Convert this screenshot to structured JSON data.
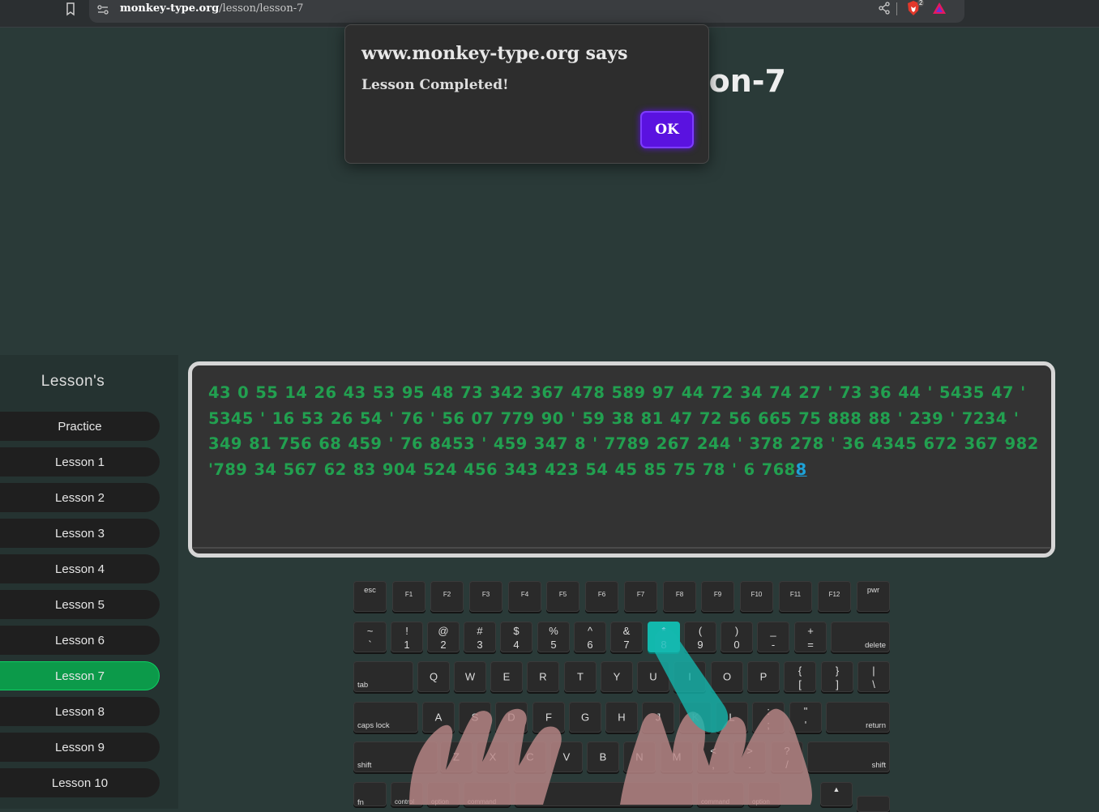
{
  "browser": {
    "url_domain": "monkey-type.org",
    "url_path": "/lesson/lesson-7",
    "brave_badge_count": "2",
    "icons": [
      "bookmark-icon",
      "site-settings-icon",
      "share-icon",
      "brave-shields-icon",
      "brave-rewards-icon"
    ]
  },
  "page": {
    "title": "Lesson-7"
  },
  "dialog": {
    "title": "www.monkey-type.org says",
    "message": "Lesson Completed!",
    "ok_label": "OK",
    "ok_color": "#5a12e0"
  },
  "sidebar": {
    "title": "Lesson's",
    "items": [
      {
        "label": "Practice"
      },
      {
        "label": "Lesson 1"
      },
      {
        "label": "Lesson 2"
      },
      {
        "label": "Lesson 3"
      },
      {
        "label": "Lesson 4"
      },
      {
        "label": "Lesson 5"
      },
      {
        "label": "Lesson 6"
      },
      {
        "label": "Lesson 7",
        "active": true
      },
      {
        "label": "Lesson 8"
      },
      {
        "label": "Lesson 9"
      },
      {
        "label": "Lesson 10"
      }
    ],
    "active_color": "#0c9a4a"
  },
  "lesson_text": {
    "typed": "43 0 55 14 26 43 53 95 48 73 342 367 478 589 97 44 72 34 74 27 ' 73 36 44 ' 5435 47 ' 5345 ' 16 53 26 54 ' 76 ' 56 07 779 90 ' 59 38 81 47 72 56 665 75 888 88 ' 239 ' 7234 ' 349 81 756 68 459 ' 76 8453 ' 459 347 8 ' 7789 267 244 ' 378 278 ' 36 4345 672 367 982 '789 34 567 62 83 904 524 456 343 423 54 45 85 75 78 ' 6 768",
    "current": "8",
    "typed_color": "#22a050",
    "current_color": "#1da2d8"
  },
  "keyboard": {
    "highlight_color": "#12b8ad",
    "function_row": [
      "esc",
      "F1",
      "F2",
      "F3",
      "F4",
      "F5",
      "F6",
      "F7",
      "F8",
      "F9",
      "F10",
      "F11",
      "F12",
      "pwr"
    ],
    "number_row": [
      {
        "top": "~",
        "bottom": "`"
      },
      {
        "top": "!",
        "bottom": "1"
      },
      {
        "top": "@",
        "bottom": "2"
      },
      {
        "top": "#",
        "bottom": "3"
      },
      {
        "top": "$",
        "bottom": "4"
      },
      {
        "top": "%",
        "bottom": "5"
      },
      {
        "top": "^",
        "bottom": "6"
      },
      {
        "top": "&",
        "bottom": "7"
      },
      {
        "top": "*",
        "bottom": "8",
        "highlight": true
      },
      {
        "top": "(",
        "bottom": "9"
      },
      {
        "top": ")",
        "bottom": "0"
      },
      {
        "top": "_",
        "bottom": "-"
      },
      {
        "top": "+",
        "bottom": "="
      },
      {
        "label": "delete"
      }
    ],
    "qwerty_row": [
      {
        "label": "tab"
      },
      {
        "c": "Q"
      },
      {
        "c": "W"
      },
      {
        "c": "E"
      },
      {
        "c": "R"
      },
      {
        "c": "T"
      },
      {
        "c": "Y"
      },
      {
        "c": "U"
      },
      {
        "c": "I"
      },
      {
        "c": "O"
      },
      {
        "c": "P"
      },
      {
        "top": "{",
        "bottom": "["
      },
      {
        "top": "}",
        "bottom": "]"
      },
      {
        "top": "|",
        "bottom": "\\"
      }
    ],
    "home_row": [
      {
        "label": "caps lock"
      },
      {
        "c": "A"
      },
      {
        "c": "S"
      },
      {
        "c": "D"
      },
      {
        "c": "F"
      },
      {
        "c": "G"
      },
      {
        "c": "H"
      },
      {
        "c": "J"
      },
      {
        "c": "K"
      },
      {
        "c": "L"
      },
      {
        "top": ":",
        "bottom": ";"
      },
      {
        "top": "\"",
        "bottom": "'"
      },
      {
        "label": "return"
      }
    ],
    "shift_row": [
      {
        "label": "shift"
      },
      {
        "c": "Z"
      },
      {
        "c": "X"
      },
      {
        "c": "C"
      },
      {
        "c": "V"
      },
      {
        "c": "B"
      },
      {
        "c": "N"
      },
      {
        "c": "M"
      },
      {
        "top": "<",
        "bottom": ","
      },
      {
        "top": ">",
        "bottom": "."
      },
      {
        "top": "?",
        "bottom": "/"
      },
      {
        "label": "shift"
      }
    ],
    "bottom_row": [
      "fn",
      "control",
      "option",
      "command",
      "",
      "command",
      "option",
      "▲",
      ""
    ]
  }
}
